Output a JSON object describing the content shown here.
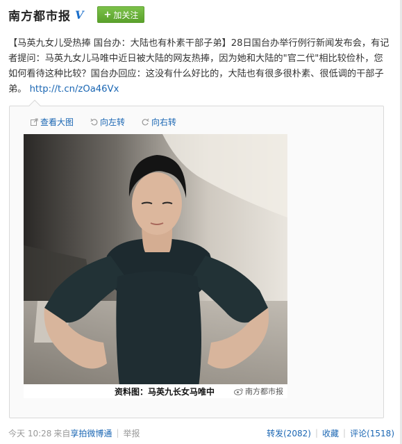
{
  "header": {
    "author": "南方都市报",
    "verified_mark": "V",
    "follow_plus": "+",
    "follow_label": "加关注"
  },
  "post": {
    "text_before_link": "【马英九女儿受热捧 国台办：大陆也有朴素干部子弟】28日国台办举行例行新闻发布会，有记者提问：马英九女儿马唯中近日被大陆的网友热捧，因为她和大陆的\"官二代\"相比较俭朴，您如何看待这种比较？国台办回应：这没有什么好比的，大陆也有很多很朴素、很低调的干部子弟。",
    "link": "http://t.cn/zOa46Vx"
  },
  "media": {
    "tools": {
      "view_large": "查看大图",
      "rotate_left": "向左转",
      "rotate_right": "向右转"
    },
    "caption": "资料图：马英九长女马唯中",
    "watermark": "南方都市报"
  },
  "footer": {
    "time": "今天 10:28",
    "source_prefix": "来自",
    "source": "享拍微博通",
    "report": "举报",
    "forward": "转发(2082)",
    "favorite": "收藏",
    "comment": "评论(1518)"
  },
  "colors": {
    "link": "#1a66b3",
    "follow_button": "#5aa12b",
    "verified": "#1b6fcb"
  }
}
